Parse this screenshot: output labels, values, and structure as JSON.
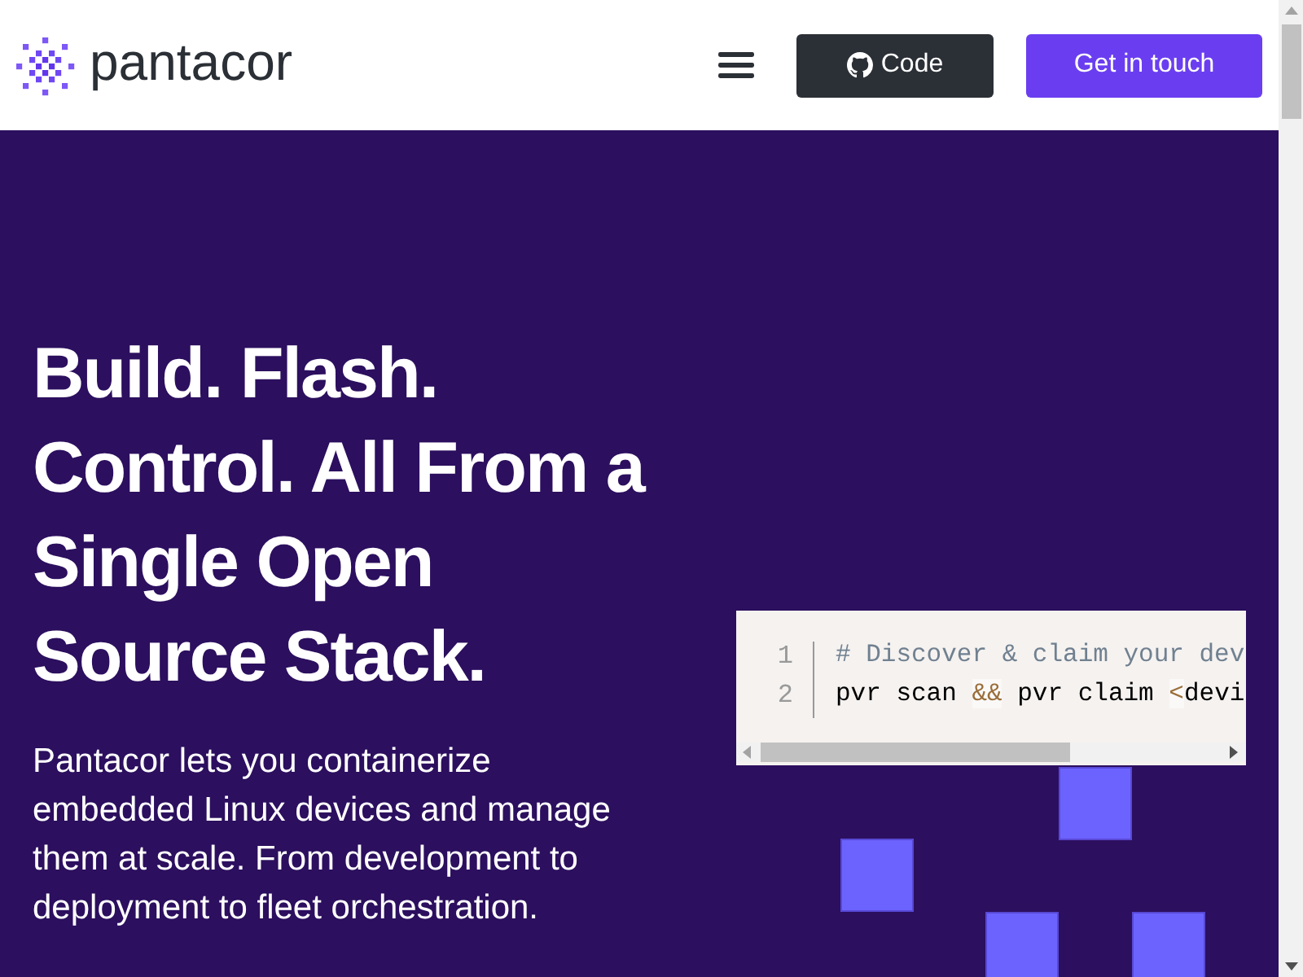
{
  "header": {
    "logo": {
      "text": "pantacor"
    },
    "buttons": [
      {
        "label": "Code",
        "kind": "github"
      },
      {
        "label": "Get in touch",
        "kind": "primary"
      }
    ]
  },
  "hero": {
    "headline": "Build. Flash. Control. All From a Single Open Source Stack.",
    "description": "Pantacor lets you containerize embedded Linux devices and manage them at scale. From development to deployment to fleet orchestration.",
    "code_block": {
      "lines": [
        {
          "number": "1",
          "segments": [
            {
              "text": "# Discover & claim your dev",
              "kind": "comment"
            }
          ]
        },
        {
          "number": "2",
          "segments": [
            {
              "text": "pvr scan ",
              "kind": "plain"
            },
            {
              "text": "&&",
              "kind": "operator"
            },
            {
              "text": " pvr claim ",
              "kind": "plain"
            },
            {
              "text": "<",
              "kind": "operator"
            },
            {
              "text": "devi",
              "kind": "plain"
            }
          ]
        }
      ]
    }
  }
}
